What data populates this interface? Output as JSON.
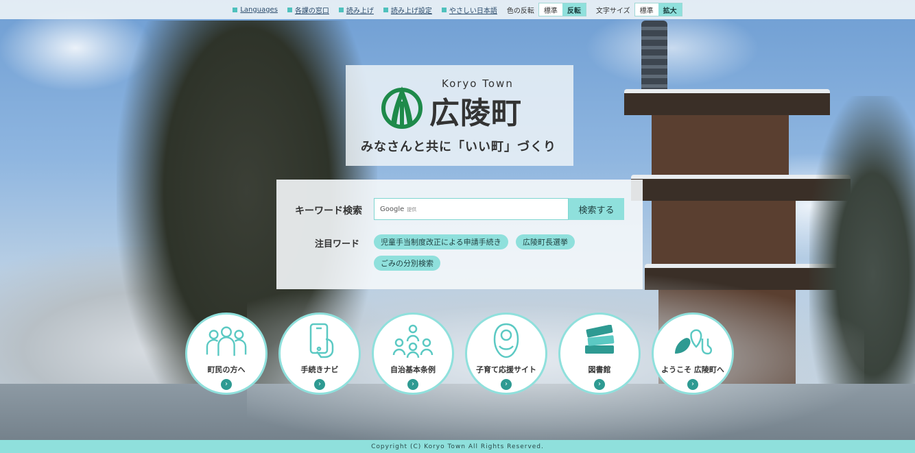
{
  "topbar": {
    "links": [
      {
        "label": "Languages"
      },
      {
        "label": "各課の窓口"
      },
      {
        "label": "読み上げ"
      },
      {
        "label": "読み上げ設定"
      },
      {
        "label": "やさしい日本語"
      }
    ],
    "contrast_label": "色の反転",
    "contrast_options": [
      "標準",
      "反転"
    ],
    "fontsize_label": "文字サイズ",
    "fontsize_options": [
      "標準",
      "拡大"
    ]
  },
  "logo": {
    "en": "Koryo Town",
    "jp": "広陵町",
    "tagline": "みなさんと共に「いい町」づくり"
  },
  "search": {
    "label": "キーワード検索",
    "provider": "Google",
    "provider_suffix": "提供",
    "button": "検索する",
    "hot_label": "注目ワード",
    "hot_words": [
      "児童手当制度改正による申請手続き",
      "広陵町長選挙",
      "ごみの分別検索"
    ]
  },
  "nav": [
    {
      "label": "町民の方へ",
      "icon": "people-icon"
    },
    {
      "label": "手続きナビ",
      "icon": "smartphone-hand-icon"
    },
    {
      "label": "自治基本条例",
      "icon": "community-icon"
    },
    {
      "label": "子育て応援サイト",
      "icon": "baby-icon"
    },
    {
      "label": "図書館",
      "icon": "books-icon"
    },
    {
      "label": "ようこそ 広陵町へ",
      "icon": "local-products-icon"
    }
  ],
  "footer": {
    "copyright": "Copyright (C) Koryo Town All Rights Reserved."
  },
  "colors": {
    "accent": "#8fe0dc",
    "accent_dark": "#2e9a92",
    "logo_green": "#1e8a4a"
  }
}
